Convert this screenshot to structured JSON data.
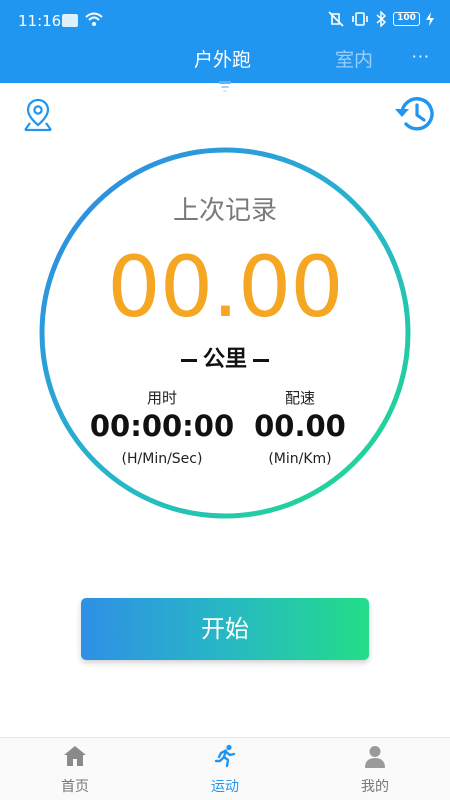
{
  "status_bar": {
    "time": "11:16",
    "battery": "100"
  },
  "header": {
    "tabs": [
      {
        "label": "户外跑",
        "active": true
      },
      {
        "label": "室内",
        "active": false
      }
    ],
    "more": "···"
  },
  "record": {
    "title": "上次记录",
    "distance": "00.00",
    "unit": "公里",
    "time_label": "用时",
    "time_value": "00:00:00",
    "time_format": "(H/Min/Sec)",
    "pace_label": "配速",
    "pace_value": "00.00",
    "pace_format": "(Min/Km)"
  },
  "start_button": "开始",
  "bottom_nav": [
    {
      "label": "首页",
      "icon": "home-icon",
      "active": false
    },
    {
      "label": "运动",
      "icon": "running-icon",
      "active": true
    },
    {
      "label": "我的",
      "icon": "user-icon",
      "active": false
    }
  ],
  "colors": {
    "brand_blue": "#2196f0",
    "distance_orange": "#f5a623",
    "gradient_start": "#2f8fe6",
    "gradient_end": "#23dd88"
  }
}
